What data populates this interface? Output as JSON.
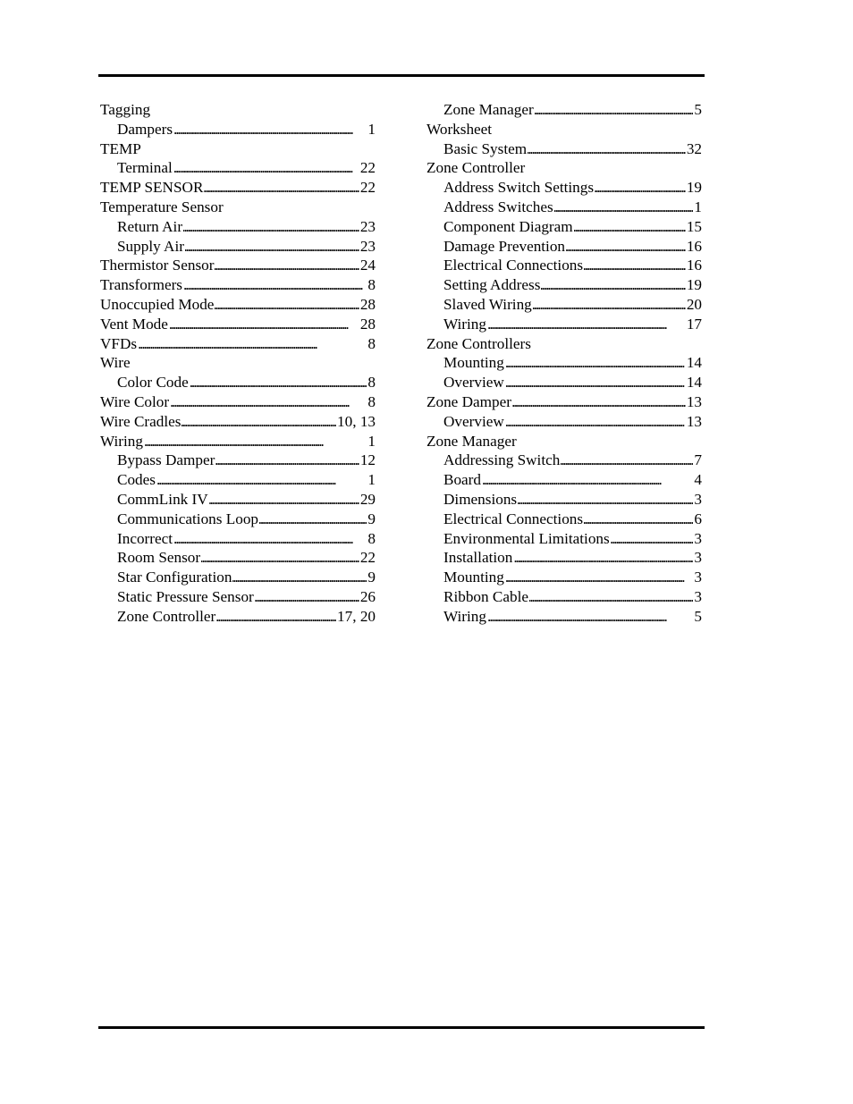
{
  "index": {
    "left_column": [
      {
        "term": "Tagging",
        "level": 0,
        "pages": ""
      },
      {
        "term": "Dampers",
        "level": 1,
        "pages": "1"
      },
      {
        "term": "TEMP",
        "level": 0,
        "pages": ""
      },
      {
        "term": "Terminal",
        "level": 1,
        "pages": "22"
      },
      {
        "term": "TEMP SENSOR",
        "level": 0,
        "pages": "22"
      },
      {
        "term": "Temperature Sensor",
        "level": 0,
        "pages": ""
      },
      {
        "term": "Return Air",
        "level": 1,
        "pages": "23"
      },
      {
        "term": "Supply Air",
        "level": 1,
        "pages": "23"
      },
      {
        "term": "Thermistor Sensor",
        "level": 0,
        "pages": "24"
      },
      {
        "term": "Transformers",
        "level": 0,
        "pages": "8"
      },
      {
        "term": "Unoccupied Mode",
        "level": 0,
        "pages": "28"
      },
      {
        "term": "Vent Mode",
        "level": 0,
        "pages": "28"
      },
      {
        "term": "VFDs",
        "level": 0,
        "pages": "8"
      },
      {
        "term": "Wire",
        "level": 0,
        "pages": ""
      },
      {
        "term": "Color Code",
        "level": 1,
        "pages": "8"
      },
      {
        "term": "Wire Color",
        "level": 0,
        "pages": "8"
      },
      {
        "term": "Wire Cradles",
        "level": 0,
        "pages": "10, 13"
      },
      {
        "term": "Wiring",
        "level": 0,
        "pages": "1"
      },
      {
        "term": "Bypass Damper",
        "level": 1,
        "pages": "12"
      },
      {
        "term": "Codes",
        "level": 1,
        "pages": "1"
      },
      {
        "term": "CommLink IV",
        "level": 1,
        "pages": "29"
      },
      {
        "term": "Communications Loop",
        "level": 1,
        "pages": "9"
      },
      {
        "term": "Incorrect",
        "level": 1,
        "pages": "8"
      },
      {
        "term": "Room Sensor",
        "level": 1,
        "pages": "22"
      },
      {
        "term": "Star Configuration",
        "level": 1,
        "pages": "9"
      },
      {
        "term": "Static Pressure Sensor",
        "level": 1,
        "pages": "26"
      },
      {
        "term": "Zone Controller",
        "level": 1,
        "pages": "17, 20"
      }
    ],
    "right_column": [
      {
        "term": "Zone Manager",
        "level": 1,
        "pages": "5"
      },
      {
        "term": "Worksheet",
        "level": 0,
        "pages": ""
      },
      {
        "term": "Basic System",
        "level": 1,
        "pages": "32"
      },
      {
        "term": "Zone Controller",
        "level": 0,
        "pages": ""
      },
      {
        "term": "Address Switch Settings",
        "level": 1,
        "pages": "19"
      },
      {
        "term": "Address Switches",
        "level": 1,
        "pages": "1"
      },
      {
        "term": "Component Diagram",
        "level": 1,
        "pages": "15"
      },
      {
        "term": "Damage Prevention",
        "level": 1,
        "pages": "16"
      },
      {
        "term": "Electrical Connections",
        "level": 1,
        "pages": "16"
      },
      {
        "term": "Setting Address",
        "level": 1,
        "pages": "19"
      },
      {
        "term": "Slaved Wiring",
        "level": 1,
        "pages": "20"
      },
      {
        "term": "Wiring",
        "level": 1,
        "pages": "17"
      },
      {
        "term": "Zone Controllers",
        "level": 0,
        "pages": ""
      },
      {
        "term": "Mounting",
        "level": 1,
        "pages": "14"
      },
      {
        "term": "Overview",
        "level": 1,
        "pages": "14"
      },
      {
        "term": "Zone Damper",
        "level": 0,
        "pages": "13"
      },
      {
        "term": "Overview",
        "level": 1,
        "pages": "13"
      },
      {
        "term": "Zone Manager",
        "level": 0,
        "pages": ""
      },
      {
        "term": "Addressing Switch",
        "level": 1,
        "pages": "7"
      },
      {
        "term": "Board",
        "level": 1,
        "pages": "4"
      },
      {
        "term": "Dimensions",
        "level": 1,
        "pages": "3"
      },
      {
        "term": "Electrical Connections",
        "level": 1,
        "pages": "6"
      },
      {
        "term": "Environmental Limitations",
        "level": 1,
        "pages": "3"
      },
      {
        "term": "Installation",
        "level": 1,
        "pages": "3"
      },
      {
        "term": "Mounting",
        "level": 1,
        "pages": "3"
      },
      {
        "term": "Ribbon Cable",
        "level": 1,
        "pages": "3"
      },
      {
        "term": "Wiring",
        "level": 1,
        "pages": "5"
      }
    ]
  }
}
